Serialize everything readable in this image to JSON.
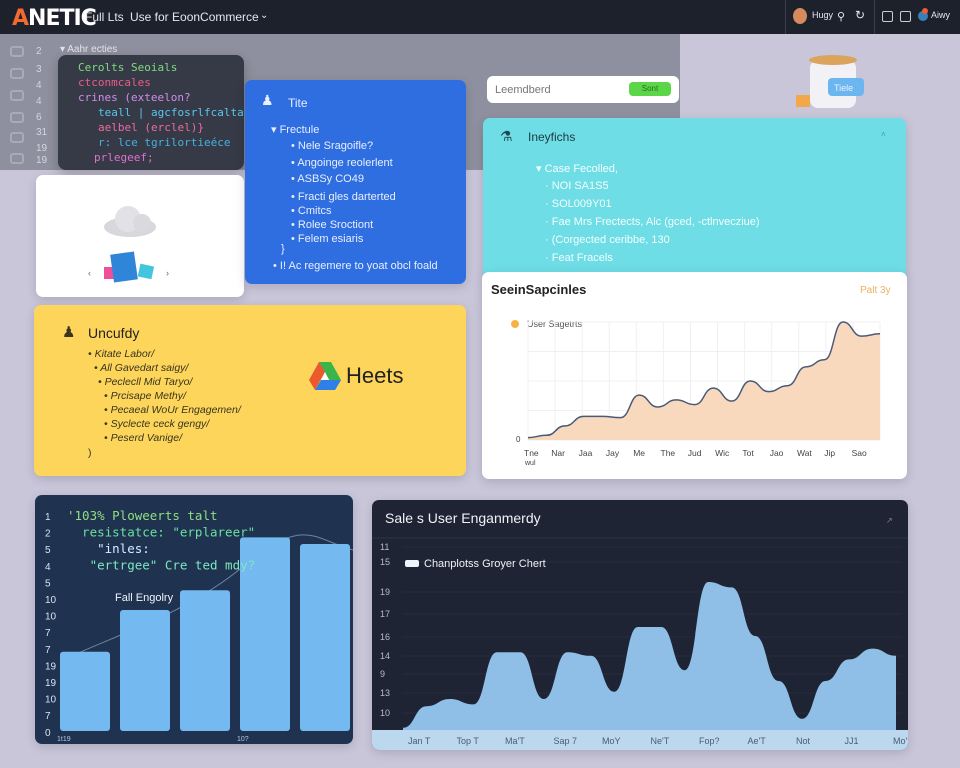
{
  "topbar": {
    "logo_accent": "A",
    "logo_rest": "NETIC",
    "nav1": "Full Lts",
    "nav2": "Use for EoonCommerce",
    "user_name": "Hugy",
    "user2_name": "Aiwy"
  },
  "editor": {
    "section_label": "Aahr ecties",
    "line_numbers": [
      "2",
      "3",
      "4",
      "4",
      "6",
      "31",
      "19",
      "19"
    ],
    "code_lines": [
      {
        "text": "Cerolts Seoials",
        "color": "#7be07b"
      },
      {
        "text": "ctconmcales",
        "color": "#ef5a8a"
      },
      {
        "text": "crines (exteelon?",
        "color": "#d48cf0"
      },
      {
        "text": "teall | agcfosrlfcalta(e",
        "color": "#5ac8f0"
      },
      {
        "text": "aelbel (erclel)}",
        "color": "#f06aa0"
      },
      {
        "text": "r: lce tgrilortieéce",
        "color": "#42b4e0"
      },
      {
        "text": "prlegeef;",
        "color": "#e070d0"
      }
    ]
  },
  "blue_card": {
    "title": "Tite",
    "section": "Frectule",
    "items": [
      "Nele Sragoifle?",
      "Angoinge reolerlent",
      "ASBSy CO49",
      "Fracti gles darterted",
      "Cmitcs",
      "Rolee Sroctiont",
      "Felem esiaris"
    ],
    "closing": "}",
    "footer": "I! Ac regemere to yoat obcl foald"
  },
  "search": {
    "value": "Leemdberd",
    "button": "Sont"
  },
  "illustration": {
    "badge": "Tiele"
  },
  "cyan_card": {
    "title": "Ineyfichs",
    "section": "Case Fecolled,",
    "items": [
      "NOI SA1S5",
      "SOL009Y01",
      "Fae Mrs Frectects,  Alc (gced, -ctlnvecziue)",
      "(Corgected ceribbe, 130",
      "Feat Fracels"
    ]
  },
  "yellow_card": {
    "title": "Uncufdy",
    "items": [
      "Kitate Labor/",
      "All Gavedart saigy/",
      "Peclecll Mid Taryo/",
      "Prcisape Methy/",
      "Pecaeal WoUr Engagemen/",
      "Syclecte ceck gengy/",
      "Peserd Vanige/"
    ],
    "closing": ")",
    "brand": "Heets"
  },
  "chart_data": [
    {
      "type": "area",
      "title": "SeeinSapcinles",
      "filter_label": "Palt 3y",
      "legend": "User Sagetrts",
      "color": "#f9d9bd",
      "line_color": "#4a5a78",
      "legend_color": "#f5b342",
      "y_tick": "0",
      "x_tick_labels": [
        "Tne",
        "Nar",
        "Jaa",
        "Jay",
        "Me",
        "The",
        "Jud",
        "Wic",
        "Tot",
        "Jao",
        "Wat",
        "Jip",
        "Sao"
      ],
      "x_sublabel": "wul",
      "values": [
        2,
        4,
        12,
        20,
        20,
        19,
        38,
        28,
        34,
        30,
        44,
        33,
        50,
        41,
        46,
        62,
        68,
        100,
        88,
        90
      ],
      "ylim": [
        0,
        100
      ],
      "grid": true
    },
    {
      "type": "bar",
      "title": "Fall Engolry",
      "categories": [
        "1t19",
        "",
        "",
        "10?",
        ""
      ],
      "values": [
        36,
        55,
        64,
        88,
        85
      ],
      "ylim": [
        0,
        100
      ],
      "y_tick_labels": [
        "1",
        "2",
        "5",
        "4",
        "5",
        "10",
        "10",
        "7",
        "7",
        "19",
        "19",
        "10",
        "7",
        "0"
      ],
      "color": "#74b9ef",
      "overlay_code": [
        {
          "text": "'103% Ploweerts talt",
          "color": "#8fe080"
        },
        {
          "text": "  resistatce: \"erplareer\"",
          "color": "#6ce0a0"
        },
        {
          "text": "    \"inles:",
          "color": "#d0f0ff"
        },
        {
          "text": "   \"ertrgee\" Cre ted mdy?",
          "color": "#7ce8c0"
        }
      ]
    },
    {
      "type": "area",
      "title": "Sale s User Enganmerdy",
      "legend": "Chanplotss Groyer Chert",
      "color": "#8fbfe6",
      "y_tick_labels": [
        "11",
        "15",
        "19",
        "17",
        "16",
        "14",
        "9",
        "13",
        "10"
      ],
      "x_tick_labels": [
        "Jan T",
        "Top T",
        "Ma'T",
        "Sap 7",
        "MoY",
        "Ne'T",
        "Fop?",
        "Ae'T",
        "Not",
        "JJ1",
        "Mo'?"
      ],
      "values": [
        4,
        16,
        20,
        17,
        46,
        46,
        20,
        46,
        44,
        24,
        60,
        60,
        36,
        85,
        82,
        55,
        30,
        9,
        30,
        42,
        48,
        44
      ],
      "ylim": [
        0,
        100
      ],
      "grid": true
    }
  ]
}
